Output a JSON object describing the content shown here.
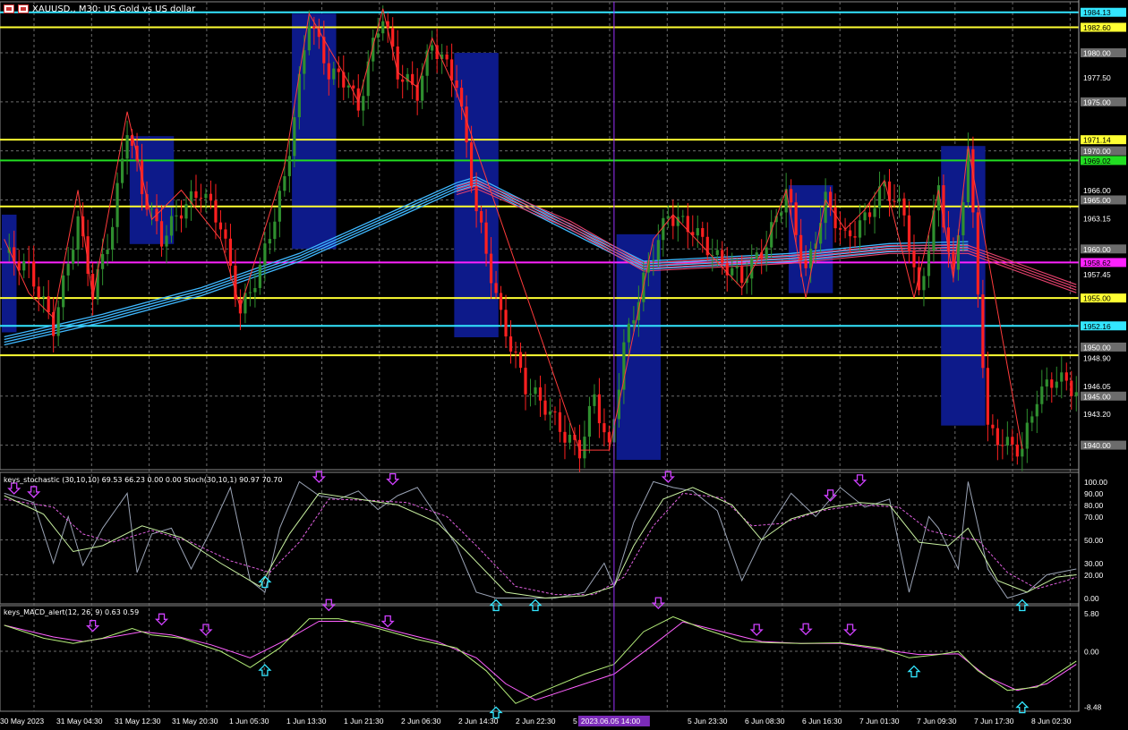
{
  "window": {
    "title": "XAUUSD., M30:  US Gold vs US dollar"
  },
  "colors": {
    "bull": "#2f8f2f",
    "bear": "#ff2020",
    "zigzag": "#ff3b3b",
    "ma_blue": "#3fb8ff",
    "ma_red": "#e8426e",
    "grid": "#6b6b6b",
    "boxes": "#0d1a8a",
    "yellow": "#ffff33",
    "cyan": "#33e6ff",
    "green": "#22dd22",
    "magenta": "#ff22ff",
    "vline": "#9b30ff",
    "arrow_down": "#d040ff",
    "arrow_up": "#33e6ff"
  },
  "price_axis": {
    "labels": [
      "1984.13",
      "1982.60",
      "1980.00",
      "1977.50",
      "1975.00",
      "1971.14",
      "1970.00",
      "1969.02",
      "1966.00",
      "1965.00",
      "1963.15",
      "1960.00",
      "1958.62",
      "1957.45",
      "1955.00",
      "1952.16",
      "1950.00",
      "1948.90",
      "1946.05",
      "1945.00",
      "1943.20",
      "1940.00"
    ]
  },
  "hlines": [
    {
      "price": "1984.13",
      "color": "cyan"
    },
    {
      "price": "1982.60",
      "color": "yellow"
    },
    {
      "price": "1971.14",
      "color": "yellow"
    },
    {
      "price": "1969.02",
      "color": "green"
    },
    {
      "price": "1964.34",
      "color": "yellow"
    },
    {
      "price": "1958.62",
      "color": "magenta"
    },
    {
      "price": "1955.00",
      "color": "yellow"
    },
    {
      "price": "1952.16",
      "color": "cyan"
    },
    {
      "price": "1949.16",
      "color": "yellow"
    }
  ],
  "stoch": {
    "label": "keys_stochastic (30,10,10) 69.53 66.23 0.00 0.00 Stoch(30,10,1) 90.97 70.70",
    "axis": [
      "100.00",
      "90.00",
      "80.00",
      "70.00",
      "50.00",
      "30.00",
      "20.00",
      "0.00"
    ]
  },
  "macd": {
    "label": "keys_MACD_alert(12, 26, 9) 0.63 0.59",
    "axis": [
      "5.80",
      "0.00",
      "-8.48"
    ]
  },
  "time_axis": {
    "labels": [
      "30 May 2023",
      "31 May 04:30",
      "31 May 12:30",
      "31 May 20:30",
      "1 Jun 05:30",
      "1 Jun 13:30",
      "1 Jun 21:30",
      "2 Jun 06:30",
      "2 Jun 14:30",
      "2 Jun 22:30",
      "5 Jun 07:30",
      "5 Jun 23:30",
      "6 Jun 08:30",
      "6 Jun 16:30",
      "7 Jun 01:30",
      "7 Jun 09:30",
      "7 Jun 17:30",
      "8 Jun 02:30"
    ],
    "crosshair": "2023.06.05 14:00"
  },
  "chart_data": {
    "type": "candlestick",
    "symbol": "XAUUSD.",
    "timeframe": "M30",
    "ylim": [
      1937.5,
      1985.2
    ],
    "close_path": [
      [
        0,
        1959.6
      ],
      [
        5,
        1958.0
      ],
      [
        10,
        1952.0
      ],
      [
        15,
        1963.0
      ],
      [
        18,
        1955.5
      ],
      [
        22,
        1962.5
      ],
      [
        25,
        1972.5
      ],
      [
        28,
        1966.0
      ],
      [
        32,
        1961.0
      ],
      [
        36,
        1964.0
      ],
      [
        40,
        1966.0
      ],
      [
        44,
        1962.5
      ],
      [
        48,
        1953.5
      ],
      [
        52,
        1958.0
      ],
      [
        57,
        1967.0
      ],
      [
        62,
        1983.6
      ],
      [
        66,
        1978.0
      ],
      [
        70,
        1977.0
      ],
      [
        72,
        1974.0
      ],
      [
        74,
        1979.0
      ],
      [
        77,
        1984.0
      ],
      [
        80,
        1978.0
      ],
      [
        84,
        1976.0
      ],
      [
        87,
        1981.0
      ],
      [
        92,
        1977.0
      ],
      [
        96,
        1964.0
      ],
      [
        101,
        1953.0
      ],
      [
        106,
        1946.0
      ],
      [
        110,
        1944.0
      ],
      [
        114,
        1941.0
      ],
      [
        117,
        1939.4
      ],
      [
        120,
        1945.0
      ],
      [
        123,
        1939.4
      ],
      [
        126,
        1950.0
      ],
      [
        131,
        1958.5
      ],
      [
        135,
        1963.5
      ],
      [
        140,
        1962.0
      ],
      [
        145,
        1959.0
      ],
      [
        150,
        1957.0
      ],
      [
        155,
        1960.5
      ],
      [
        159,
        1966.0
      ],
      [
        163,
        1957.5
      ],
      [
        167,
        1965.0
      ],
      [
        171,
        1961.0
      ],
      [
        175,
        1963.0
      ],
      [
        179,
        1966.5
      ],
      [
        183,
        1963.5
      ],
      [
        186,
        1955.0
      ],
      [
        190,
        1966.0
      ],
      [
        193,
        1957.0
      ],
      [
        196,
        1970.0
      ],
      [
        200,
        1941.5
      ],
      [
        204,
        1940.0
      ],
      [
        207,
        1939.6
      ],
      [
        210,
        1945.0
      ],
      [
        214,
        1947.0
      ],
      [
        218,
        1945.5
      ]
    ],
    "zigzag": [
      [
        0,
        1961.0
      ],
      [
        5,
        1955.5
      ],
      [
        10,
        1953.0
      ],
      [
        15,
        1966.0
      ],
      [
        18,
        1955.0
      ],
      [
        25,
        1974.0
      ],
      [
        30,
        1963.0
      ],
      [
        36,
        1966.0
      ],
      [
        44,
        1961.0
      ],
      [
        48,
        1954.0
      ],
      [
        57,
        1968.5
      ],
      [
        62,
        1984.0
      ],
      [
        70,
        1977.0
      ],
      [
        72,
        1975.0
      ],
      [
        77,
        1984.5
      ],
      [
        80,
        1978.0
      ],
      [
        84,
        1976.5
      ],
      [
        87,
        1981.5
      ],
      [
        92,
        1976.0
      ],
      [
        117,
        1939.5
      ],
      [
        123,
        1939.5
      ],
      [
        132,
        1961.0
      ],
      [
        136,
        1963.5
      ],
      [
        150,
        1956.0
      ],
      [
        155,
        1960.5
      ],
      [
        159,
        1966.0
      ],
      [
        163,
        1955.0
      ],
      [
        167,
        1965.0
      ],
      [
        171,
        1962.0
      ],
      [
        175,
        1964.0
      ],
      [
        179,
        1967.0
      ],
      [
        185,
        1955.0
      ],
      [
        190,
        1966.0
      ],
      [
        193,
        1957.0
      ],
      [
        196,
        1970.5
      ],
      [
        207,
        1939.6
      ]
    ],
    "ma_blue": [
      [
        0,
        1950.5
      ],
      [
        20,
        1952.8
      ],
      [
        40,
        1955.5
      ],
      [
        60,
        1959.0
      ],
      [
        80,
        1963.5
      ],
      [
        92,
        1966.2
      ],
      [
        96,
        1966.8
      ],
      [
        130,
        1958.2
      ],
      [
        160,
        1959.0
      ],
      [
        180,
        1960.0
      ],
      [
        196,
        1960.2
      ]
    ],
    "ma_red": [
      [
        92,
        1966.0
      ],
      [
        96,
        1966.6
      ],
      [
        115,
        1962.5
      ],
      [
        130,
        1958.2
      ],
      [
        160,
        1959.0
      ],
      [
        180,
        1960.0
      ],
      [
        196,
        1960.0
      ],
      [
        218,
        1956.0
      ]
    ],
    "boxes": [
      [
        0,
        2,
        1963.5,
        1951.5
      ],
      [
        26,
        34,
        1971.5,
        1960.5
      ],
      [
        59,
        67,
        1984.0,
        1960.0
      ],
      [
        92,
        100,
        1980.0,
        1951.0
      ],
      [
        125,
        133,
        1961.5,
        1938.5
      ],
      [
        160,
        168,
        1966.5,
        1955.5
      ],
      [
        191,
        199,
        1970.5,
        1942.0
      ]
    ],
    "vline_index": 124,
    "stoch_fast": [
      [
        0,
        90
      ],
      [
        6,
        82
      ],
      [
        10,
        30
      ],
      [
        13,
        70
      ],
      [
        16,
        28
      ],
      [
        20,
        60
      ],
      [
        25,
        90
      ],
      [
        27,
        22
      ],
      [
        30,
        55
      ],
      [
        34,
        60
      ],
      [
        38,
        25
      ],
      [
        42,
        58
      ],
      [
        46,
        95
      ],
      [
        50,
        15
      ],
      [
        53,
        5
      ],
      [
        56,
        60
      ],
      [
        60,
        100
      ],
      [
        64,
        88
      ],
      [
        68,
        85
      ],
      [
        72,
        92
      ],
      [
        76,
        76
      ],
      [
        80,
        88
      ],
      [
        84,
        95
      ],
      [
        88,
        70
      ],
      [
        92,
        45
      ],
      [
        96,
        5
      ],
      [
        100,
        0
      ],
      [
        106,
        0
      ],
      [
        112,
        0
      ],
      [
        118,
        5
      ],
      [
        122,
        30
      ],
      [
        124,
        10
      ],
      [
        128,
        65
      ],
      [
        132,
        100
      ],
      [
        136,
        95
      ],
      [
        140,
        92
      ],
      [
        145,
        75
      ],
      [
        150,
        15
      ],
      [
        154,
        50
      ],
      [
        160,
        90
      ],
      [
        165,
        70
      ],
      [
        170,
        95
      ],
      [
        175,
        78
      ],
      [
        180,
        85
      ],
      [
        184,
        5
      ],
      [
        188,
        70
      ],
      [
        190,
        60
      ],
      [
        194,
        25
      ],
      [
        196,
        100
      ],
      [
        200,
        25
      ],
      [
        204,
        0
      ],
      [
        208,
        5
      ],
      [
        212,
        20
      ],
      [
        218,
        25
      ]
    ],
    "stoch_slow": [
      [
        0,
        88
      ],
      [
        8,
        72
      ],
      [
        14,
        40
      ],
      [
        20,
        45
      ],
      [
        28,
        62
      ],
      [
        36,
        52
      ],
      [
        44,
        30
      ],
      [
        52,
        10
      ],
      [
        58,
        55
      ],
      [
        64,
        90
      ],
      [
        72,
        85
      ],
      [
        80,
        80
      ],
      [
        88,
        65
      ],
      [
        94,
        40
      ],
      [
        102,
        5
      ],
      [
        110,
        0
      ],
      [
        118,
        2
      ],
      [
        124,
        10
      ],
      [
        128,
        45
      ],
      [
        134,
        85
      ],
      [
        140,
        95
      ],
      [
        148,
        80
      ],
      [
        154,
        50
      ],
      [
        160,
        68
      ],
      [
        168,
        78
      ],
      [
        174,
        82
      ],
      [
        180,
        80
      ],
      [
        186,
        48
      ],
      [
        192,
        45
      ],
      [
        196,
        60
      ],
      [
        202,
        15
      ],
      [
        208,
        5
      ],
      [
        214,
        18
      ],
      [
        218,
        20
      ]
    ],
    "stoch_sig": [
      [
        0,
        85
      ],
      [
        10,
        78
      ],
      [
        16,
        55
      ],
      [
        22,
        48
      ],
      [
        30,
        58
      ],
      [
        38,
        48
      ],
      [
        46,
        32
      ],
      [
        54,
        22
      ],
      [
        60,
        48
      ],
      [
        66,
        85
      ],
      [
        74,
        84
      ],
      [
        82,
        82
      ],
      [
        90,
        70
      ],
      [
        96,
        45
      ],
      [
        104,
        10
      ],
      [
        112,
        3
      ],
      [
        120,
        3
      ],
      [
        126,
        18
      ],
      [
        132,
        62
      ],
      [
        138,
        90
      ],
      [
        146,
        86
      ],
      [
        152,
        62
      ],
      [
        158,
        64
      ],
      [
        166,
        75
      ],
      [
        174,
        80
      ],
      [
        182,
        78
      ],
      [
        188,
        58
      ],
      [
        194,
        52
      ],
      [
        198,
        50
      ],
      [
        204,
        22
      ],
      [
        210,
        8
      ],
      [
        216,
        15
      ],
      [
        218,
        18
      ]
    ],
    "macd_main": [
      [
        0,
        4.0
      ],
      [
        8,
        2.0
      ],
      [
        14,
        1.2
      ],
      [
        20,
        2.0
      ],
      [
        26,
        3.5
      ],
      [
        30,
        2.5
      ],
      [
        36,
        2.0
      ],
      [
        44,
        0.0
      ],
      [
        50,
        -2.5
      ],
      [
        56,
        0.5
      ],
      [
        62,
        5.0
      ],
      [
        68,
        5.0
      ],
      [
        76,
        3.5
      ],
      [
        84,
        1.8
      ],
      [
        92,
        0.5
      ],
      [
        98,
        -3.0
      ],
      [
        104,
        -8.0
      ],
      [
        110,
        -6.0
      ],
      [
        118,
        -3.5
      ],
      [
        124,
        -2.0
      ],
      [
        130,
        3.0
      ],
      [
        136,
        5.3
      ],
      [
        142,
        3.5
      ],
      [
        150,
        1.5
      ],
      [
        156,
        1.3
      ],
      [
        162,
        1.2
      ],
      [
        170,
        1.3
      ],
      [
        178,
        0.5
      ],
      [
        184,
        -1.0
      ],
      [
        190,
        -0.5
      ],
      [
        194,
        0.0
      ],
      [
        198,
        -3.0
      ],
      [
        204,
        -6.0
      ],
      [
        210,
        -5.5
      ],
      [
        218,
        -1.5
      ]
    ],
    "macd_signal": [
      [
        0,
        4.0
      ],
      [
        10,
        2.2
      ],
      [
        16,
        1.5
      ],
      [
        22,
        2.2
      ],
      [
        28,
        3.0
      ],
      [
        34,
        2.5
      ],
      [
        42,
        1.0
      ],
      [
        50,
        -1.0
      ],
      [
        58,
        2.0
      ],
      [
        64,
        4.6
      ],
      [
        72,
        4.6
      ],
      [
        80,
        3.0
      ],
      [
        88,
        1.5
      ],
      [
        96,
        -1.0
      ],
      [
        102,
        -5.0
      ],
      [
        108,
        -7.5
      ],
      [
        116,
        -5.5
      ],
      [
        124,
        -3.5
      ],
      [
        132,
        1.0
      ],
      [
        138,
        4.5
      ],
      [
        146,
        3.0
      ],
      [
        154,
        1.5
      ],
      [
        162,
        1.2
      ],
      [
        170,
        1.2
      ],
      [
        178,
        0.3
      ],
      [
        186,
        -0.5
      ],
      [
        194,
        -0.4
      ],
      [
        200,
        -4.0
      ],
      [
        206,
        -6.0
      ],
      [
        212,
        -5.0
      ],
      [
        218,
        -2.0
      ]
    ],
    "stoch_arrows": [
      [
        "d",
        2,
        88
      ],
      [
        "d",
        6,
        85
      ],
      [
        "u",
        53,
        20
      ],
      [
        "d",
        64,
        98
      ],
      [
        "d",
        79,
        96
      ],
      [
        "u",
        100,
        0
      ],
      [
        "u",
        108,
        0
      ],
      [
        "d",
        135,
        98
      ],
      [
        "d",
        168,
        82
      ],
      [
        "d",
        174,
        95
      ],
      [
        "u",
        207,
        0
      ]
    ],
    "macd_arrows": [
      [
        "d",
        18,
        2.8
      ],
      [
        "d",
        32,
        3.8
      ],
      [
        "d",
        41,
        2.2
      ],
      [
        "u",
        53,
        -1.8
      ],
      [
        "d",
        66,
        6.0
      ],
      [
        "d",
        78,
        3.5
      ],
      [
        "u",
        100,
        -8.3
      ],
      [
        "d",
        133,
        6.3
      ],
      [
        "d",
        153,
        2.2
      ],
      [
        "d",
        163,
        2.3
      ],
      [
        "d",
        172,
        2.2
      ],
      [
        "u",
        185,
        -2.0
      ],
      [
        "u",
        207,
        -7.5
      ]
    ]
  }
}
